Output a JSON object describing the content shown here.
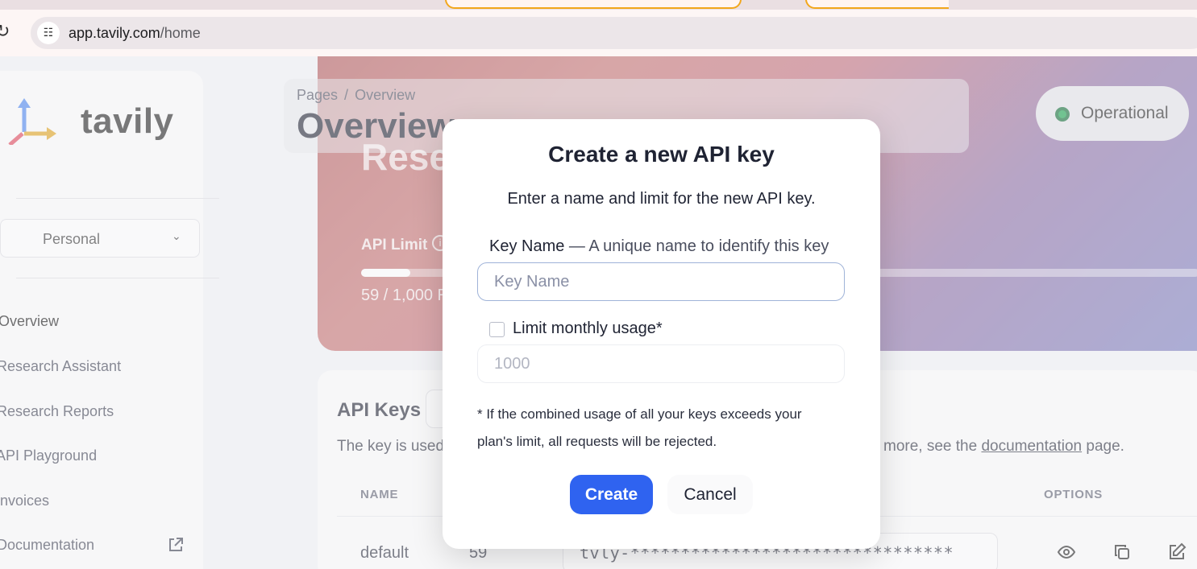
{
  "browser": {
    "reload_icon": "reload-icon",
    "site_info_icon": "tune-icon",
    "url_host": "app.tavily.com",
    "url_path": "/home"
  },
  "sidebar": {
    "logo_text": "tavily",
    "team_select": "Personal",
    "items": [
      {
        "label": "Overview"
      },
      {
        "label": "Research Assistant"
      },
      {
        "label": "Research Reports"
      },
      {
        "label": "API Playground"
      },
      {
        "label": "Invoices"
      },
      {
        "label": "Documentation"
      }
    ]
  },
  "header": {
    "breadcrumb_root": "Pages",
    "breadcrumb_sep": "/",
    "breadcrumb_current": "Overview",
    "title": "Overview",
    "status": "Operational",
    "status_color": "#16a34a"
  },
  "hero": {
    "title_fragment": "Rese",
    "api_limit_label": "API Limit",
    "usage_text": "59 / 1,000 R",
    "usage_fraction": 0.059
  },
  "api_keys": {
    "title": "API Keys",
    "desc_start": "The key is used",
    "desc_end_pre": "more, see the ",
    "desc_link": "documentation",
    "desc_end_post": " page.",
    "columns": {
      "name": "NAME",
      "options": "OPTIONS"
    },
    "row": {
      "name": "default",
      "usage": "59",
      "key": "tvly-********************************"
    }
  },
  "modal": {
    "title": "Create a new API key",
    "subtitle": "Enter a name and limit for the new API key.",
    "key_name_label": "Key Name",
    "key_name_hint": " — A unique name to identify this key",
    "key_name_placeholder": "Key Name",
    "limit_label": "Limit monthly usage*",
    "limit_placeholder": "1000",
    "note": "* If the combined usage of all your keys exceeds your plan's limit, all requests will be rejected.",
    "create_label": "Create",
    "cancel_label": "Cancel",
    "accent_color": "#2f63f0"
  }
}
